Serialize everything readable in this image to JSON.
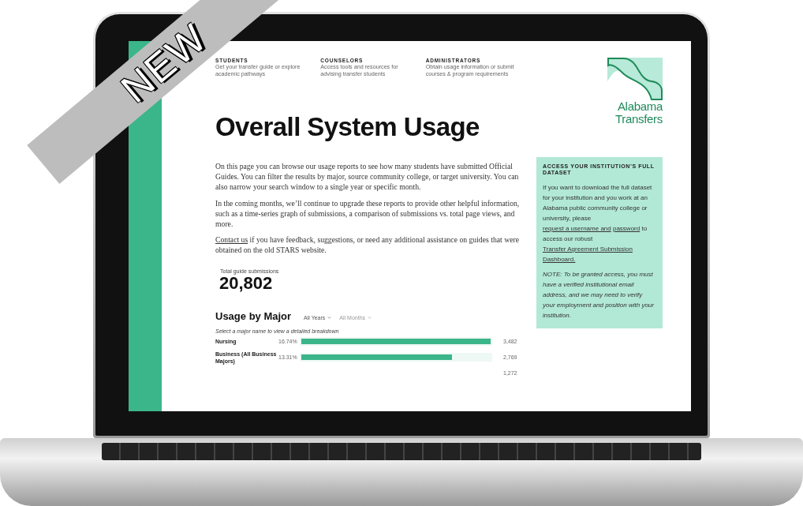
{
  "badge": "NEW",
  "nav": [
    {
      "heading": "STUDENTS",
      "text": "Get your transfer guide or explore academic pathways"
    },
    {
      "heading": "COUNSELORS",
      "text": "Access tools and resources for advising transfer students"
    },
    {
      "heading": "ADMINISTRATORS",
      "text": "Obtain usage information or submit courses & program requirements"
    }
  ],
  "logo": [
    "Alabama",
    "Transfers"
  ],
  "title": "Overall System Usage",
  "intro": [
    {
      "parts": [
        {
          "kind": "text",
          "text": "On this page you can browse our usage reports to see how many students have submitted Official Guides. You can filter the results by major, source community college, or target university. You can also narrow your search window to a single year or specific month."
        }
      ]
    },
    {
      "parts": [
        {
          "kind": "text",
          "text": "In the coming months, we’ll continue to upgrade these reports to provide other helpful information, such as a time-series graph of submissions, a comparison of submissions vs. total page views, and more."
        }
      ]
    },
    {
      "parts": [
        {
          "kind": "link",
          "text": "Contact us"
        },
        {
          "kind": "text",
          "text": " if you have feedback, suggestions, or need any additional assistance on guides that were obtained on the old STARS website."
        }
      ]
    }
  ],
  "total": {
    "label": "Total guide submissions",
    "value": "20,802"
  },
  "usage": {
    "title": "Usage by Major",
    "filters": [
      {
        "label": "All Years",
        "disabled": false
      },
      {
        "label": "All Months",
        "disabled": true
      }
    ],
    "hint": "Select a major name to view a detailed breakdown",
    "rows": [
      {
        "name": "Nursing",
        "percent": "16.74%",
        "count": "3,482",
        "level": 1
      },
      {
        "name": "Business (All Business Majors)",
        "percent": "13.31%",
        "count": "2,769",
        "level": 0.795
      },
      {
        "count": "1,272"
      }
    ]
  },
  "access_box": {
    "heading": "ACCESS YOUR INSTITUTION’S FULL DATASET",
    "parts": [
      {
        "kind": "text",
        "text": "If you want to download the full dataset for your institution and you work at an Alabama public community college or university, please "
      },
      {
        "kind": "link",
        "text": "request a username and"
      },
      {
        "kind": "link",
        "text": "password"
      },
      {
        "kind": "text",
        "text": " to access our robust "
      },
      {
        "kind": "link",
        "text": "Transfer Agreement Submission"
      },
      {
        "kind": "link",
        "text": "Dashboard."
      }
    ],
    "note": "NOTE: To be granted access, you must have a verified institutional email address, and we may need to verify your employment and position with your institution."
  }
}
